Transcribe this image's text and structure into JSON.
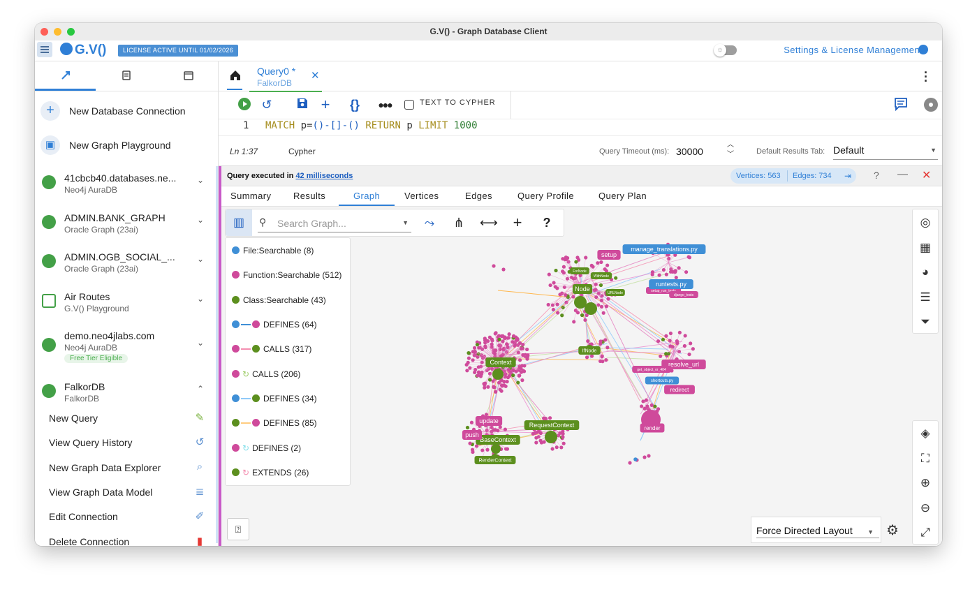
{
  "window": {
    "title": "G.V() - Graph Database Client"
  },
  "appbar": {
    "logo": "G.V()",
    "license_badge": "LICENSE ACTIVE UNTIL 01/02/2026",
    "settings_link": "Settings & License Management"
  },
  "sidebar": {
    "actions": [
      {
        "label": "New Database Connection",
        "icon": "plus-icon"
      },
      {
        "label": "New Graph Playground",
        "icon": "playground-icon"
      }
    ],
    "connections": [
      {
        "name": "41cbcb40.databases.ne...",
        "type": "Neo4j AuraDB"
      },
      {
        "name": "ADMIN.BANK_GRAPH",
        "type": "Oracle Graph (23ai)"
      },
      {
        "name": "ADMIN.OGB_SOCIAL_...",
        "type": "Oracle Graph (23ai)"
      },
      {
        "name": "Air Routes",
        "type": "G.V() Playground"
      },
      {
        "name": "demo.neo4jlabs.com",
        "type": "Neo4j AuraDB",
        "badge": "Free Tier Eligible"
      },
      {
        "name": "FalkorDB",
        "type": "FalkorDB"
      }
    ],
    "falkor_items": [
      {
        "label": "New Query",
        "icon": "magic-wand-icon"
      },
      {
        "label": "View Query History",
        "icon": "history-icon"
      },
      {
        "label": "New Graph Data Explorer",
        "icon": "search-database-icon"
      },
      {
        "label": "View Graph Data Model",
        "icon": "database-icon"
      },
      {
        "label": "Edit Connection",
        "icon": "edit-icon"
      },
      {
        "label": "Delete Connection",
        "icon": "trash-icon"
      }
    ]
  },
  "query_tab": {
    "title": "Query0 *",
    "subtitle": "FalkorDB"
  },
  "toolbar": {
    "text_to_cypher": "TEXT TO CYPHER"
  },
  "editor": {
    "line_number": "1",
    "tokens": [
      "MATCH",
      " p=",
      "()-[]-()",
      " RETURN",
      " p ",
      "LIMIT",
      " ",
      "1000"
    ]
  },
  "status_bar": {
    "position": "Ln 1:37",
    "language": "Cypher",
    "timeout_label": "Query Timeout (ms):",
    "timeout_value": "30000",
    "default_tab_label": "Default Results Tab:",
    "default_tab_value": "Default"
  },
  "results": {
    "executed_prefix": "Query executed in",
    "executed_time": "42 milliseconds",
    "vertices": "Vertices: 563",
    "edges": "Edges: 734",
    "tabs": [
      "Summary",
      "Results",
      "Graph",
      "Vertices",
      "Edges",
      "Query Profile",
      "Query Plan"
    ],
    "active_tab": "Graph"
  },
  "graph_toolbar": {
    "search_placeholder": "Search Graph..."
  },
  "legend": [
    {
      "label": "File:Searchable (8)",
      "color": "#3f8fd6"
    },
    {
      "label": "Function:Searchable (512)",
      "color": "#cf4a9b"
    },
    {
      "label": "Class:Searchable (43)",
      "color": "#5c8f1e"
    },
    {
      "label": "DEFINES (64)",
      "from": "#3f8fd6",
      "to": "#cf4a9b"
    },
    {
      "label": "CALLS (317)",
      "from": "#cf4a9b",
      "to": "#5c8f1e"
    },
    {
      "label": "CALLS (206)",
      "from": "#cf4a9b",
      "loop": "#9ccc65"
    },
    {
      "label": "DEFINES (34)",
      "from": "#3f8fd6",
      "to": "#5c8f1e"
    },
    {
      "label": "DEFINES (85)",
      "from": "#5c8f1e",
      "to": "#cf4a9b"
    },
    {
      "label": "DEFINES (2)",
      "from": "#cf4a9b",
      "loop": "#80deea"
    },
    {
      "label": "EXTENDS (26)",
      "from": "#5c8f1e",
      "loop": "#f48fb1"
    }
  ],
  "graph_labels": {
    "green": [
      "Node",
      "Context",
      "RequestContext",
      "BaseContext",
      "RenderContext",
      "IfNode",
      "ForNode",
      "WithNode",
      "URLNode"
    ],
    "pink": [
      "setup",
      "update",
      "push",
      "resolve_url",
      "redirect",
      "render",
      "get_object_or_404",
      "setup_run_tests",
      "django_tests"
    ],
    "blue": [
      "manage_translations.py",
      "runtests.py",
      "shortcuts.py"
    ]
  },
  "layout": {
    "value": "Force Directed Layout"
  }
}
